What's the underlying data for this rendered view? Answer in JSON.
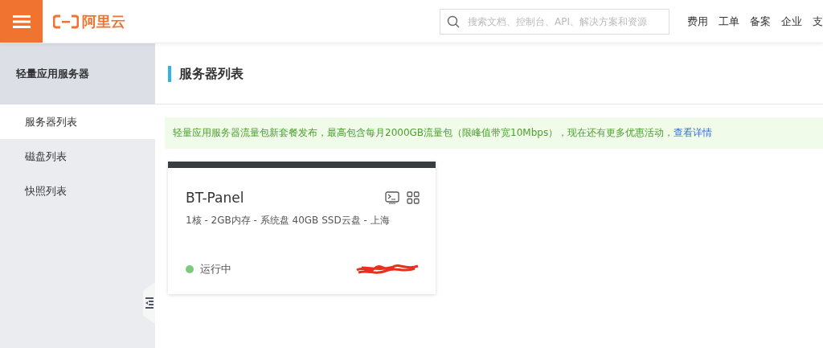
{
  "header": {
    "logo_text": "阿里云",
    "search": {
      "placeholder": "搜索文档、控制台、API、解决方案和资源"
    },
    "nav": [
      "费用",
      "工单",
      "备案",
      "企业",
      "支"
    ]
  },
  "sidebar": {
    "title": "轻量应用服务器",
    "items": [
      {
        "label": "服务器列表",
        "selected": true
      },
      {
        "label": "磁盘列表",
        "selected": false
      },
      {
        "label": "快照列表",
        "selected": false
      }
    ]
  },
  "page_title": "服务器列表",
  "notice": {
    "text": "轻量应用服务器流量包新套餐发布，最高包含每月2000GB流量包（限峰值带宽10Mbps），现在还有更多优惠活动，",
    "link": "查看详情"
  },
  "servers": [
    {
      "name": "BT-Panel",
      "spec": "1核 - 2GB内存 - 系统盘 40GB SSD云盘 - 上海",
      "status": "运行中",
      "color": "#7ccb7c"
    }
  ]
}
